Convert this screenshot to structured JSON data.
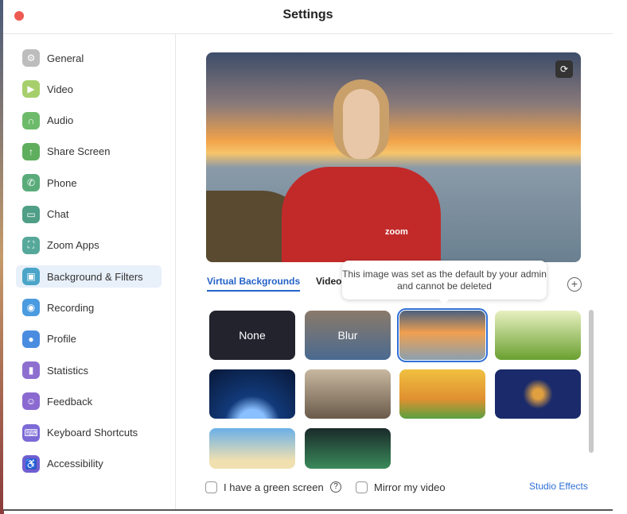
{
  "window": {
    "title": "Settings"
  },
  "sidebar": {
    "items": [
      {
        "label": "General",
        "icon": "gear-icon",
        "color": "#bdbdbd",
        "glyph": "⚙"
      },
      {
        "label": "Video",
        "icon": "video-camera-icon",
        "color": "#a6cf6b",
        "glyph": "▶"
      },
      {
        "label": "Audio",
        "icon": "headphones-icon",
        "color": "#6dbb6a",
        "glyph": "∩"
      },
      {
        "label": "Share Screen",
        "icon": "share-screen-icon",
        "color": "#5fae5e",
        "glyph": "↑"
      },
      {
        "label": "Phone",
        "icon": "phone-icon",
        "color": "#5aab7a",
        "glyph": "✆"
      },
      {
        "label": "Chat",
        "icon": "chat-icon",
        "color": "#4f9e86",
        "glyph": "▭"
      },
      {
        "label": "Zoom Apps",
        "icon": "zoom-apps-icon",
        "color": "#56a89a",
        "glyph": "⛶"
      },
      {
        "label": "Background & Filters",
        "icon": "background-icon",
        "color": "#4aa5c8",
        "glyph": "▣",
        "selected": true
      },
      {
        "label": "Recording",
        "icon": "record-icon",
        "color": "#4a9be0",
        "glyph": "◉"
      },
      {
        "label": "Profile",
        "icon": "profile-icon",
        "color": "#4a8de0",
        "glyph": "●"
      },
      {
        "label": "Statistics",
        "icon": "statistics-icon",
        "color": "#8e6fd0",
        "glyph": "▮"
      },
      {
        "label": "Feedback",
        "icon": "feedback-icon",
        "color": "#8a6ad0",
        "glyph": "☺"
      },
      {
        "label": "Keyboard Shortcuts",
        "icon": "keyboard-icon",
        "color": "#7c6ad6",
        "glyph": "⌨"
      },
      {
        "label": "Accessibility",
        "icon": "accessibility-icon",
        "color": "#6f5fd0",
        "glyph": "♿"
      }
    ]
  },
  "preview": {
    "logo": "zoom"
  },
  "tabs": [
    {
      "label": "Virtual Backgrounds",
      "active": true
    },
    {
      "label": "Video"
    }
  ],
  "tooltip": "This image was set as the default by your admin and cannot be deleted",
  "tiles": [
    {
      "label": "None",
      "bg": "#23232e"
    },
    {
      "label": "Blur",
      "bg": "linear-gradient(#8a7a6a,#4a6a90)"
    },
    {
      "label": "",
      "bg": "linear-gradient(#4a6080,#f0a050 45%,#8aa0b0)",
      "selected": true
    },
    {
      "label": "",
      "bg": "linear-gradient(#e8f0c0,#6aa030)"
    },
    {
      "label": "",
      "bg": "radial-gradient(circle at 50% 110%,#8ac0ff 20%,#123a7a 40%,#081838)"
    },
    {
      "label": "",
      "bg": "linear-gradient(#c8b8a0,#6a5a4a)"
    },
    {
      "label": "",
      "bg": "linear-gradient(#f0c040,#e09030 60%,#5aa040)"
    },
    {
      "label": "",
      "bg": "radial-gradient(circle,#e0a040 10%,#1a2a6a 30%)"
    },
    {
      "label": "",
      "bg": "linear-gradient(#6ab0e8,#f0e0b0 80%)"
    },
    {
      "label": "",
      "bg": "linear-gradient(#1a2a2a,#3a8a5a)"
    }
  ],
  "options": {
    "green_screen": "I have a green screen",
    "mirror": "Mirror my video",
    "studio": "Studio Effects"
  }
}
